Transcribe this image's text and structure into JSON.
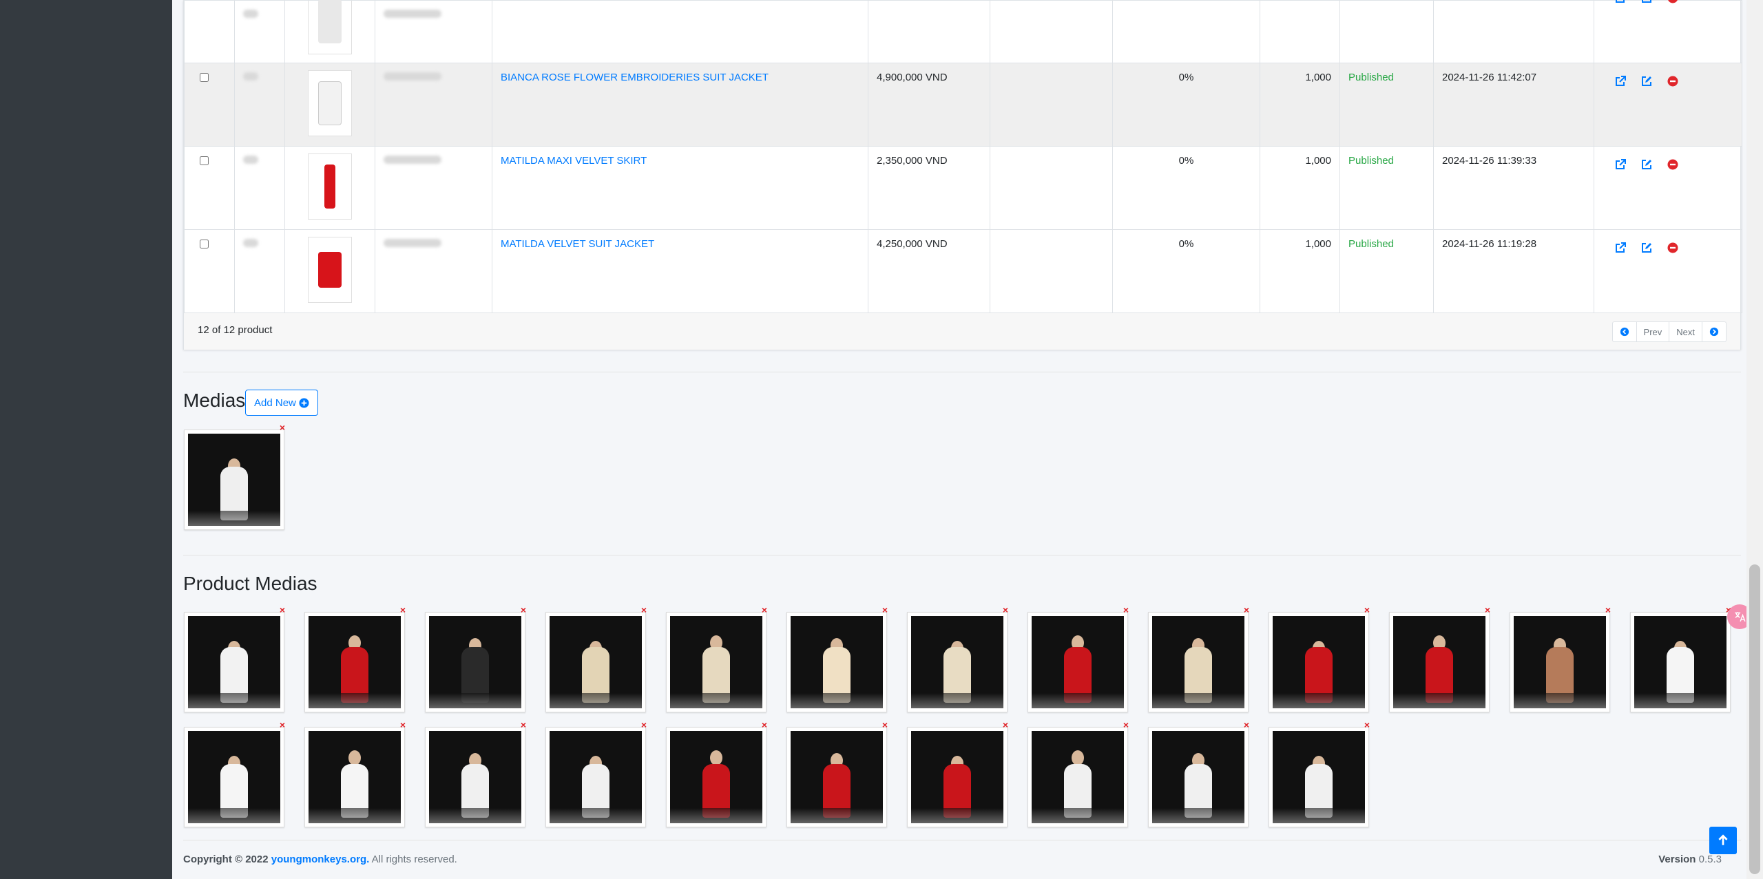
{
  "table": {
    "rows": [
      {
        "name": "",
        "price": "",
        "discount": "",
        "qty": "",
        "status": "",
        "date": "",
        "variant": "partial",
        "thumb_color": "#e8e8e8"
      },
      {
        "name": "BIANCA ROSE FLOWER EMBROIDERIES SUIT JACKET",
        "price": "4,900,000 VND",
        "discount": "0%",
        "qty": "1,000",
        "status": "Published",
        "date": "2024-11-26 11:42:07",
        "variant": "alt",
        "thumb_color": "#f2f2f2"
      },
      {
        "name": "MATILDA MAXI VELVET SKIRT",
        "price": "2,350,000 VND",
        "discount": "0%",
        "qty": "1,000",
        "status": "Published",
        "date": "2024-11-26 11:39:33",
        "variant": "",
        "thumb_color": "#d7141a"
      },
      {
        "name": "MATILDA VELVET SUIT JACKET",
        "price": "4,250,000 VND",
        "discount": "0%",
        "qty": "1,000",
        "status": "Published",
        "date": "2024-11-26 11:19:28",
        "variant": "",
        "thumb_color": "#d7141a"
      }
    ],
    "count_text": "12 of 12 product",
    "pager": {
      "prev": "Prev",
      "next": "Next"
    }
  },
  "medias": {
    "title": "Medias",
    "add_label": "Add New",
    "items": [
      {
        "outfit": "#efefef"
      }
    ]
  },
  "product_medias": {
    "title": "Product Medias",
    "row1": [
      {
        "outfit": "#f2f2f2"
      },
      {
        "outfit": "#c9151b"
      },
      {
        "outfit": "#2a2a2a"
      },
      {
        "outfit": "#e3d4b5"
      },
      {
        "outfit": "#e6d9bf"
      },
      {
        "outfit": "#f0e0c4"
      },
      {
        "outfit": "#e8dcc3"
      },
      {
        "outfit": "#c9151b"
      },
      {
        "outfit": "#e5d7bb"
      },
      {
        "outfit": "#c9151b"
      },
      {
        "outfit": "#c9151b"
      },
      {
        "outfit": "#b57b5a"
      },
      {
        "outfit": "#f5f5f5"
      }
    ],
    "row2": [
      {
        "outfit": "#f5f5f5"
      },
      {
        "outfit": "#f5f5f5"
      },
      {
        "outfit": "#f0f0f0"
      },
      {
        "outfit": "#f0f0f0"
      },
      {
        "outfit": "#c9151b"
      },
      {
        "outfit": "#c9151b"
      },
      {
        "outfit": "#c9151b"
      },
      {
        "outfit": "#f0f0f0"
      },
      {
        "outfit": "#f0f0f0"
      },
      {
        "outfit": "#f0f0f0"
      }
    ]
  },
  "footer": {
    "copyright_prefix": "Copyright © 2022",
    "site": "youngmonkeys.org.",
    "rights": "All rights reserved.",
    "version_label": "Version",
    "version_value": "0.5.3"
  }
}
